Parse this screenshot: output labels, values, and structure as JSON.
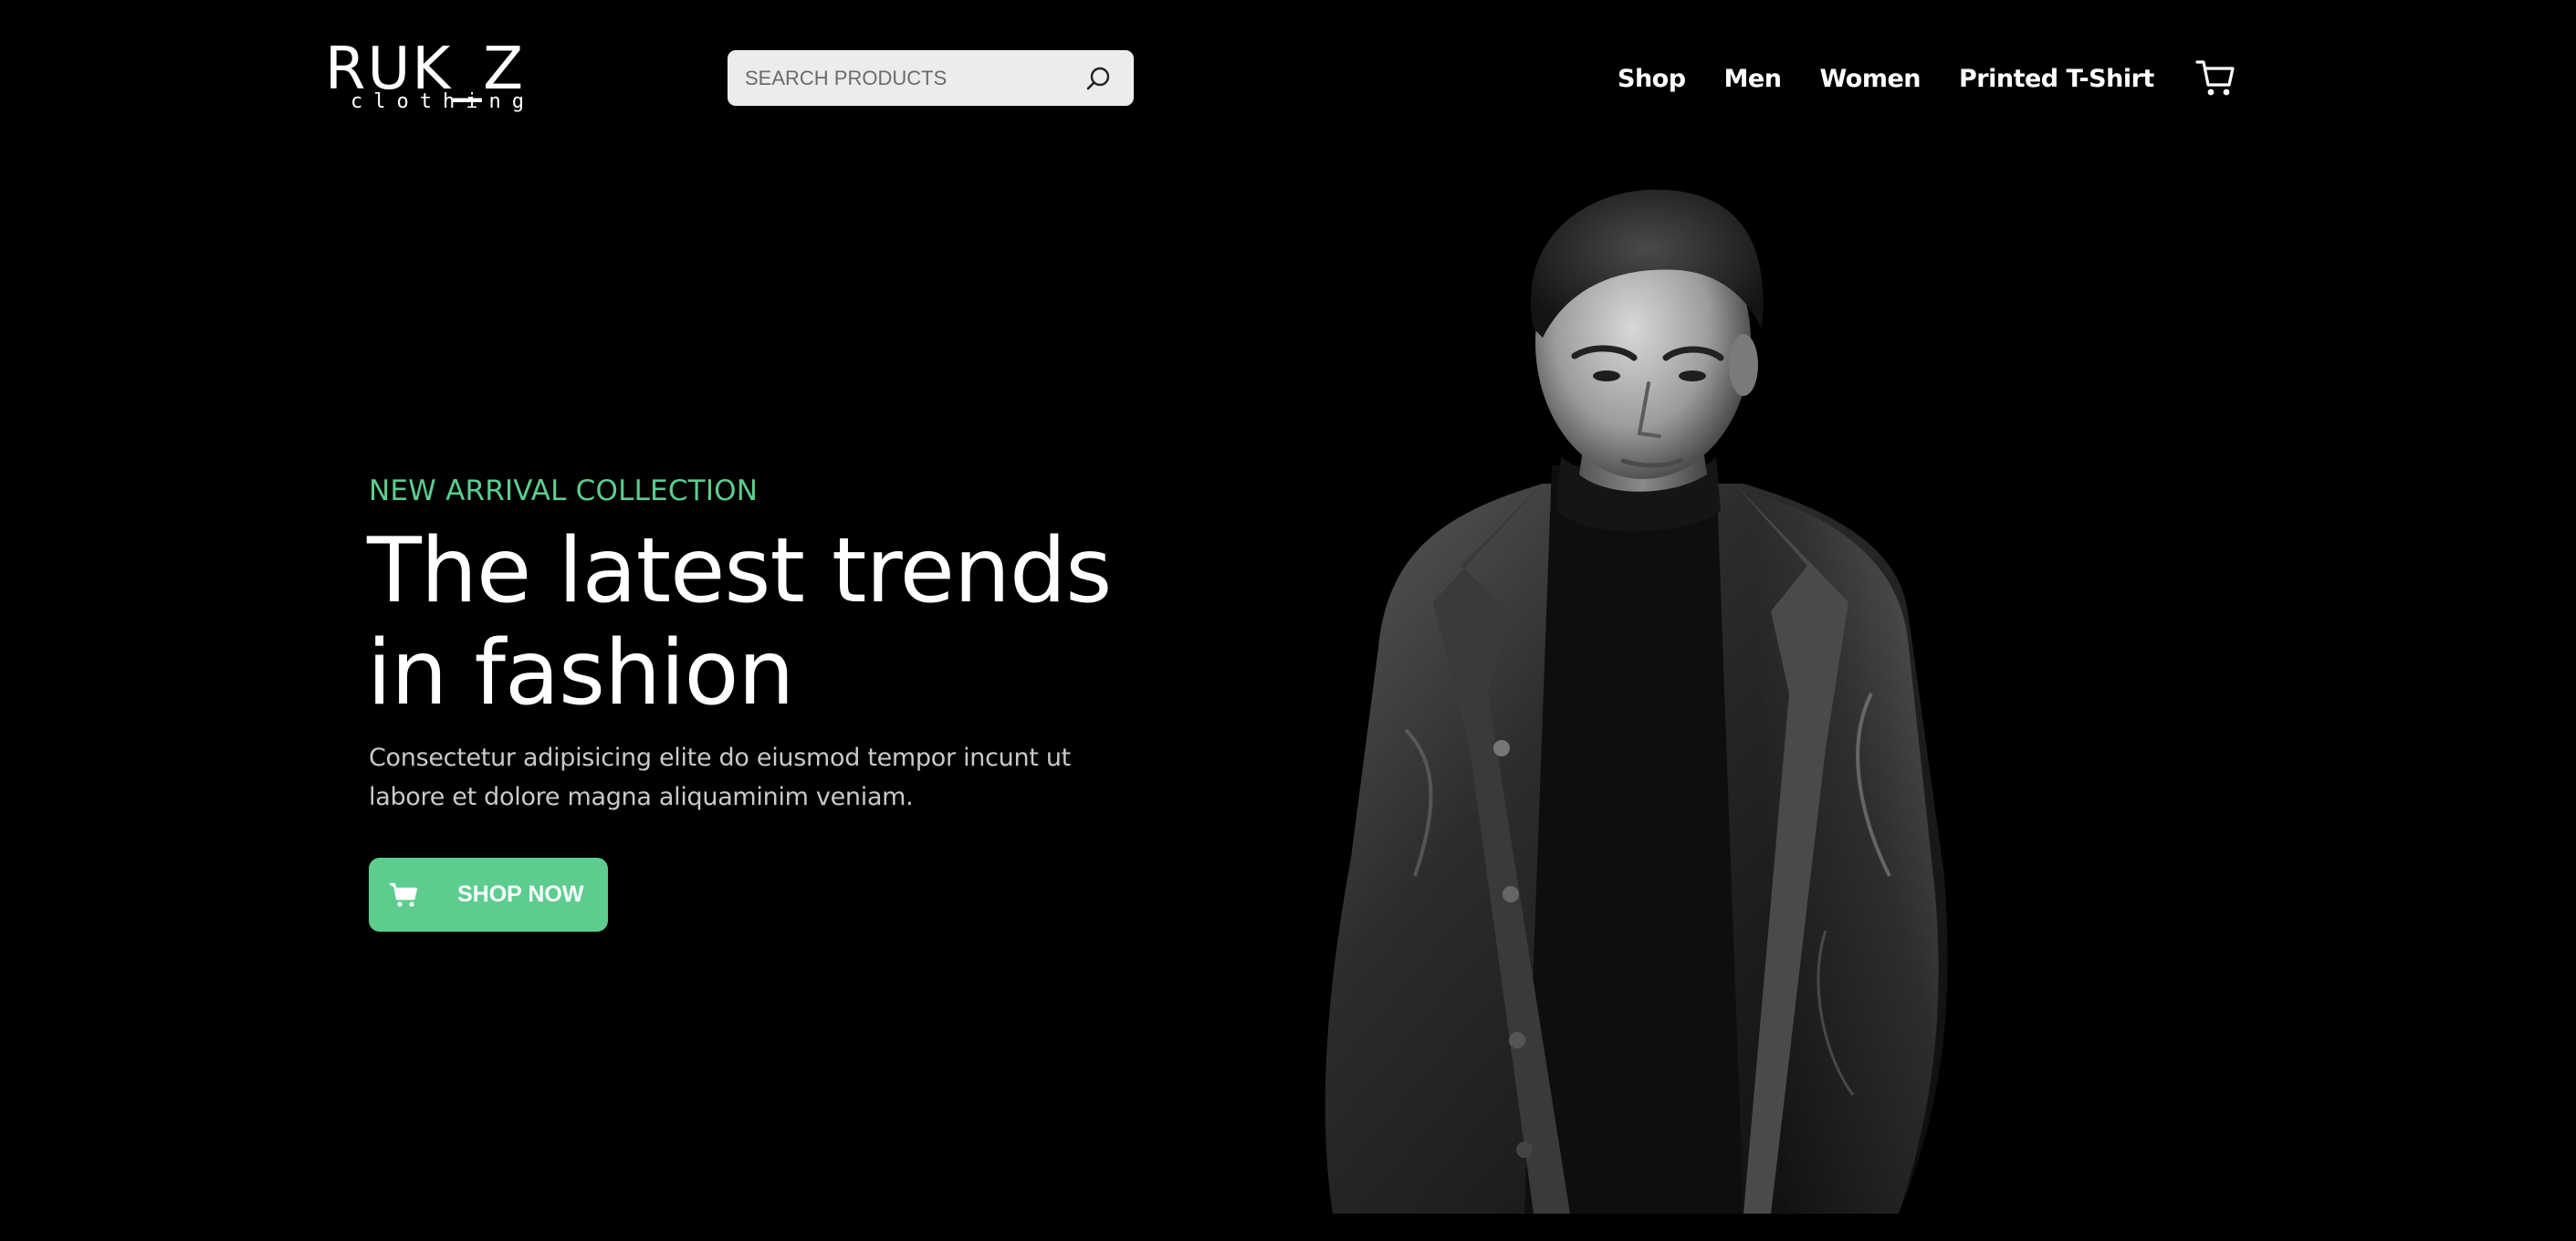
{
  "header": {
    "logo": {
      "word": "RUK_Z",
      "sub": "clothing"
    },
    "search": {
      "placeholder": "SEARCH PRODUCTS",
      "value": "",
      "icon": "search-icon"
    },
    "nav": [
      {
        "label": "Shop"
      },
      {
        "label": "Men"
      },
      {
        "label": "Women"
      },
      {
        "label": "Printed T-Shirt"
      }
    ],
    "cart_icon": "cart-icon"
  },
  "hero": {
    "eyebrow": "NEW ARRIVAL COLLECTION",
    "headline_lines": [
      "The latest trends",
      "in fashion"
    ],
    "description_lines": [
      "Consectetur adipisicing elite do eiusmod tempor incunt ut",
      "labore et dolore magna aliquaminim veniam."
    ],
    "cta": {
      "label": "SHOP NOW",
      "icon": "cart-icon"
    },
    "image": "model-in-black-leather-jacket"
  },
  "colors": {
    "background": "#000000",
    "accent": "#5ccd8f",
    "text": "#ffffff",
    "muted_text": "#c9c9c9",
    "search_bg": "#ececec"
  }
}
